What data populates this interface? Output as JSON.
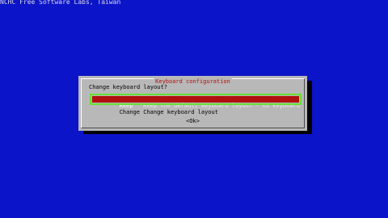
{
  "backtitle": "NCHC Free Software Labs, Taiwan",
  "dialog": {
    "title": "Keyboard configuration",
    "prompt": "Change keyboard layout?",
    "menu": [
      {
        "key": "Keep",
        "description": "Keep the default keyboard layout - US keyboard",
        "selected": true
      },
      {
        "key": "Change",
        "description": "Change keyboard layout",
        "selected": false
      }
    ],
    "ok_label": "<Ok>"
  },
  "colors": {
    "background": "#0b14c8",
    "dialog": "#b8b8b8",
    "selection": "#b01010",
    "focus_outline": "#66e030",
    "title": "#b01010"
  }
}
